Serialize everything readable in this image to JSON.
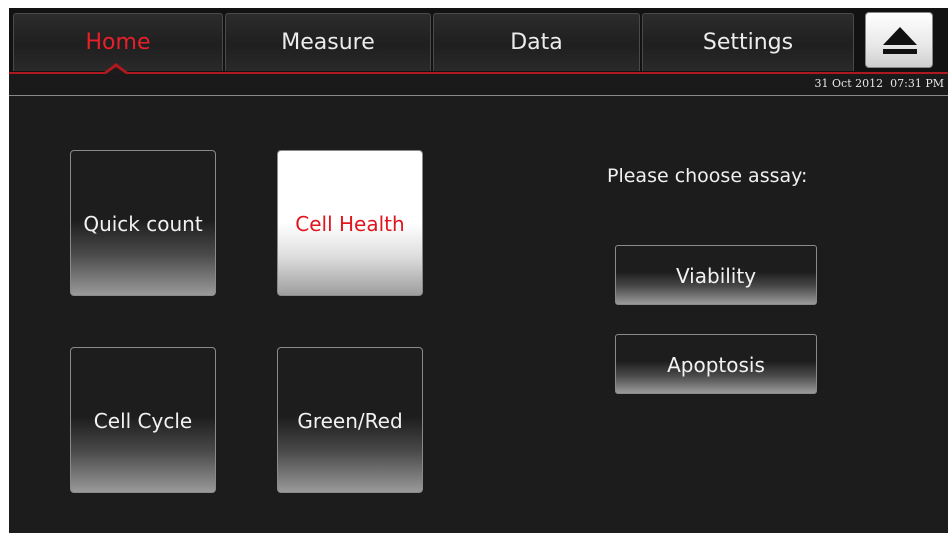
{
  "tabs": [
    {
      "label": "Home",
      "active": true
    },
    {
      "label": "Measure",
      "active": false
    },
    {
      "label": "Data",
      "active": false
    },
    {
      "label": "Settings",
      "active": false
    }
  ],
  "eject": {
    "icon": "eject-icon"
  },
  "status": {
    "datetime": "31 Oct 2012  07:31 PM"
  },
  "tiles": [
    {
      "label": "Quick count",
      "selected": false
    },
    {
      "label": "Cell Health",
      "selected": true
    },
    {
      "label": "Cell Cycle",
      "selected": false
    },
    {
      "label": "Green/Red",
      "selected": false
    }
  ],
  "assay": {
    "prompt": "Please choose assay:",
    "options": [
      {
        "label": "Viability"
      },
      {
        "label": "Apoptosis"
      }
    ]
  },
  "colors": {
    "accent": "#e8202a",
    "background": "#1c1c1c",
    "divider_red": "#b01820"
  }
}
